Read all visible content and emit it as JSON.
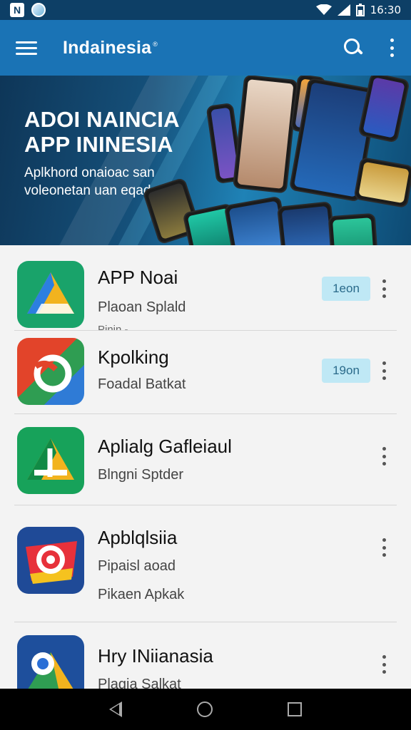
{
  "status_bar": {
    "left_badge": "N",
    "time": "16:30"
  },
  "app_bar": {
    "title": "Indainesia",
    "title_mark": "®"
  },
  "banner": {
    "headline_line1": "ADOI NAINCIA",
    "headline_line2": "APP ININESIA",
    "sub_line1": "Aplkhord onaioac san",
    "sub_line2": "voleonetan uan eqads"
  },
  "apps": [
    {
      "name": "APP Noai",
      "subtitle": "Plaoan Splald",
      "extra": "Pinin -",
      "badge": "1eon",
      "icon": "triangle-app-icon"
    },
    {
      "name": "Kpolking",
      "subtitle": "Foadal Batkat",
      "extra": "",
      "badge": "19on",
      "icon": "swirl-app-icon"
    },
    {
      "name": "Aplialg Gafleiaul",
      "subtitle": "Blngni Sptder",
      "extra": "",
      "badge": "",
      "icon": "arrow-triangle-app-icon"
    },
    {
      "name": "Apblqlsiia",
      "subtitle": "Pipaisl aoad",
      "extra": "Pikaen Apkak",
      "badge": "",
      "icon": "target-app-icon"
    },
    {
      "name": "Hry INiianasia",
      "subtitle": "Plagia Salkat",
      "extra": "",
      "badge": "",
      "icon": "map-pin-app-icon"
    }
  ],
  "colors": {
    "app_bar": "#1a73b5",
    "status_bar": "#0d3f66",
    "badge_bg": "#bfe8f5",
    "list_bg": "#f3f3f3"
  }
}
